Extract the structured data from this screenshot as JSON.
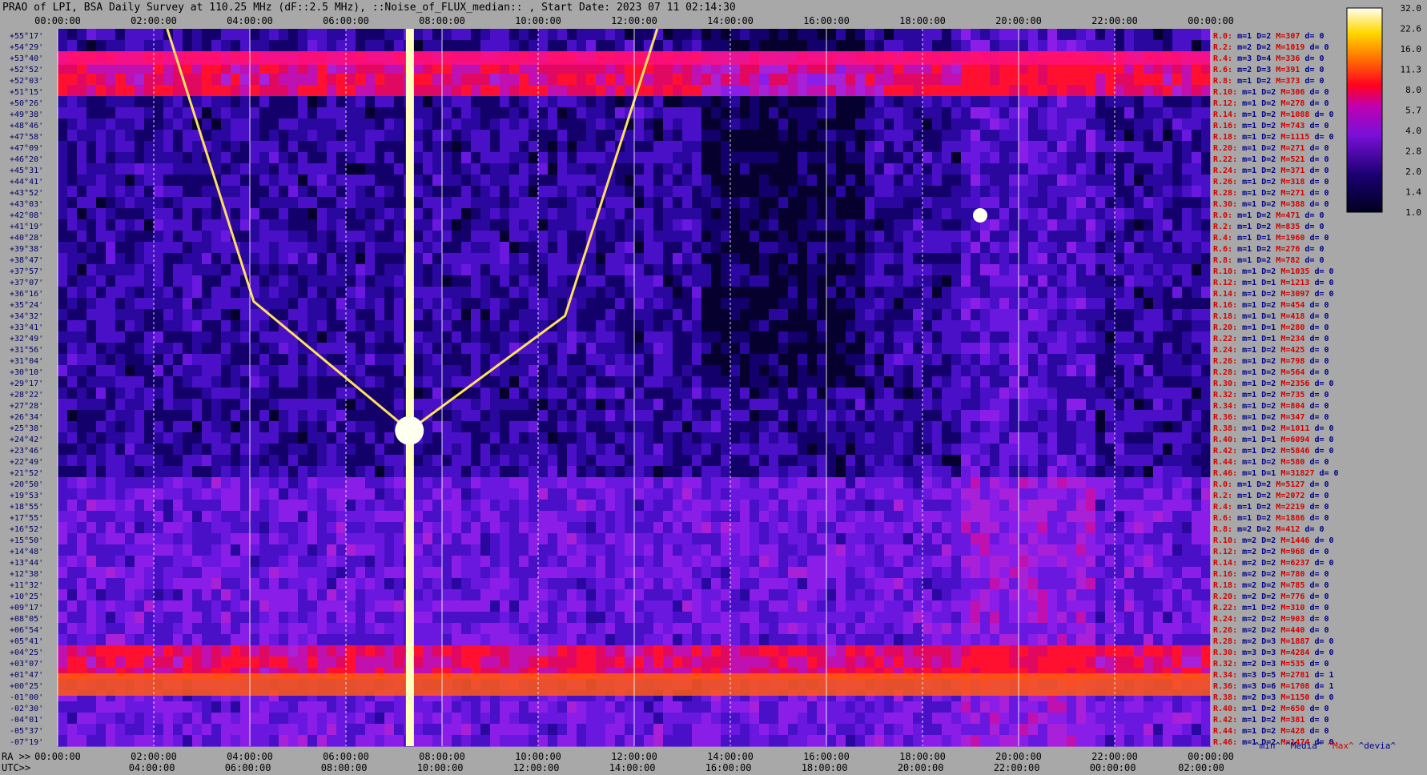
{
  "title": "PRAO of LPI, BSA Daily Survey at 110.25 MHz (dF::2.5 MHz), ::Noise_of_FLUX_median:: , Start Date: 2023 07 11 02:14:30",
  "colors": {
    "background": "#a8a8a8",
    "low": "#050030",
    "mid": "#8a1ee0",
    "high": "#ff1030",
    "peak": "#fffff0",
    "beam_label_red": "#d40000",
    "beam_label_blue": "#00008c",
    "gridline": "#ffffff"
  },
  "legend": [
    {
      "label": "^min^",
      "color": "#00008c"
    },
    {
      "label": "^Media^",
      "color": "#00008c"
    },
    {
      "label": "^Max^",
      "color": "#d40000"
    },
    {
      "label": "^devia^",
      "color": "#00008c"
    }
  ],
  "chart_data": {
    "type": "heatmap",
    "title": "PRAO of LPI, BSA Daily Survey at 110.25 MHz (dF::2.5 MHz), ::Noise_of_FLUX_median:: , Start Date: 2023 07 11 02:14:30",
    "x_axis_top": {
      "label": "",
      "ticks": [
        "00:00:00",
        "02:00:00",
        "04:00:00",
        "06:00:00",
        "08:00:00",
        "10:00:00",
        "12:00:00",
        "14:00:00",
        "16:00:00",
        "18:00:00",
        "20:00:00",
        "22:00:00",
        "00:00:00"
      ]
    },
    "x_axis_bottom_ra": {
      "label": "RA >>",
      "ticks": [
        "00:00:00",
        "02:00:00",
        "04:00:00",
        "06:00:00",
        "08:00:00",
        "10:00:00",
        "12:00:00",
        "14:00:00",
        "16:00:00",
        "18:00:00",
        "20:00:00",
        "22:00:00",
        "00:00:00"
      ]
    },
    "x_axis_bottom_utc": {
      "label": "UTC>>",
      "ticks": [
        "04:00:00",
        "06:00:00",
        "08:00:00",
        "10:00:00",
        "12:00:00",
        "14:00:00",
        "16:00:00",
        "18:00:00",
        "20:00:00",
        "22:00:00",
        "00:00:00",
        "02:00:00"
      ]
    },
    "y_declinations": [
      "+55°17'",
      "+54°29'",
      "+53°40'",
      "+52°52'",
      "+52°03'",
      "+51°15'",
      "+50°26'",
      "+49°38'",
      "+48°46'",
      "+47°58'",
      "+47°09'",
      "+46°20'",
      "+45°31'",
      "+44°41'",
      "+43°52'",
      "+43°03'",
      "+42°08'",
      "+41°19'",
      "+40°28'",
      "+39°38'",
      "+38°47'",
      "+37°57'",
      "+37°07'",
      "+36°16'",
      "+35°24'",
      "+34°32'",
      "+33°41'",
      "+32°49'",
      "+31°56'",
      "+31°04'",
      "+30°10'",
      "+29°17'",
      "+28°22'",
      "+27°28'",
      "+26°34'",
      "+25°38'",
      "+24°42'",
      "+23°46'",
      "+22°49'",
      "+21°52'",
      "+20°50'",
      "+19°53'",
      "+18°55'",
      "+17°55'",
      "+16°52'",
      "+15°50'",
      "+14°48'",
      "+13°44'",
      "+12°38'",
      "+11°32'",
      "+10°25'",
      "+09°17'",
      "+08°05'",
      "+06°54'",
      "+05°41'",
      "+04°25'",
      "+03°07'",
      "+01°47'",
      "+00°25'",
      "-01°00'",
      "-02°30'",
      "-04°01'",
      "-05°37'",
      "-07°19'"
    ],
    "colorbar": {
      "ticks": [
        "32.0",
        "22.6",
        "16.0",
        "11.3",
        "8.0",
        "5.7",
        "4.0",
        "2.8",
        "2.0",
        "1.4",
        "1.0"
      ],
      "scale": "log"
    },
    "beams": [
      {
        "name": "R.0:",
        "m": 1,
        "D": 2,
        "M": 307,
        "d": 0
      },
      {
        "name": "R.2:",
        "m": 2,
        "D": 2,
        "M": 1019,
        "d": 0
      },
      {
        "name": "R.4:",
        "m": 3,
        "D": 4,
        "M": 336,
        "d": 0
      },
      {
        "name": "R.6:",
        "m": 2,
        "D": 3,
        "M": 391,
        "d": 0
      },
      {
        "name": "R.8:",
        "m": 1,
        "D": 2,
        "M": 373,
        "d": 0
      },
      {
        "name": "R.10:",
        "m": 1,
        "D": 2,
        "M": 306,
        "d": 0
      },
      {
        "name": "R.12:",
        "m": 1,
        "D": 2,
        "M": 278,
        "d": 0
      },
      {
        "name": "R.14:",
        "m": 1,
        "D": 2,
        "M": 1088,
        "d": 0
      },
      {
        "name": "R.16:",
        "m": 1,
        "D": 2,
        "M": 743,
        "d": 0
      },
      {
        "name": "R.18:",
        "m": 1,
        "D": 2,
        "M": 1115,
        "d": 0
      },
      {
        "name": "R.20:",
        "m": 1,
        "D": 2,
        "M": 271,
        "d": 0
      },
      {
        "name": "R.22:",
        "m": 1,
        "D": 2,
        "M": 521,
        "d": 0
      },
      {
        "name": "R.24:",
        "m": 1,
        "D": 2,
        "M": 371,
        "d": 0
      },
      {
        "name": "R.26:",
        "m": 1,
        "D": 2,
        "M": 318,
        "d": 0
      },
      {
        "name": "R.28:",
        "m": 1,
        "D": 2,
        "M": 271,
        "d": 0
      },
      {
        "name": "R.30:",
        "m": 1,
        "D": 2,
        "M": 388,
        "d": 0
      },
      {
        "name": "R.0:",
        "m": 1,
        "D": 2,
        "M": 471,
        "d": 0
      },
      {
        "name": "R.2:",
        "m": 1,
        "D": 2,
        "M": 835,
        "d": 0
      },
      {
        "name": "R.4:",
        "m": 1,
        "D": 1,
        "M": 1960,
        "d": 0
      },
      {
        "name": "R.6:",
        "m": 1,
        "D": 2,
        "M": 276,
        "d": 0
      },
      {
        "name": "R.8:",
        "m": 1,
        "D": 2,
        "M": 782,
        "d": 0
      },
      {
        "name": "R.10:",
        "m": 1,
        "D": 2,
        "M": 1035,
        "d": 0
      },
      {
        "name": "R.12:",
        "m": 1,
        "D": 1,
        "M": 1213,
        "d": 0
      },
      {
        "name": "R.14:",
        "m": 1,
        "D": 2,
        "M": 3097,
        "d": 0
      },
      {
        "name": "R.16:",
        "m": 1,
        "D": 2,
        "M": 454,
        "d": 0
      },
      {
        "name": "R.18:",
        "m": 1,
        "D": 1,
        "M": 418,
        "d": 0
      },
      {
        "name": "R.20:",
        "m": 1,
        "D": 1,
        "M": 280,
        "d": 0
      },
      {
        "name": "R.22:",
        "m": 1,
        "D": 1,
        "M": 234,
        "d": 0
      },
      {
        "name": "R.24:",
        "m": 1,
        "D": 2,
        "M": 425,
        "d": 0
      },
      {
        "name": "R.26:",
        "m": 1,
        "D": 2,
        "M": 798,
        "d": 0
      },
      {
        "name": "R.28:",
        "m": 1,
        "D": 2,
        "M": 564,
        "d": 0
      },
      {
        "name": "R.30:",
        "m": 1,
        "D": 2,
        "M": 2356,
        "d": 0
      },
      {
        "name": "R.32:",
        "m": 1,
        "D": 2,
        "M": 735,
        "d": 0
      },
      {
        "name": "R.34:",
        "m": 1,
        "D": 2,
        "M": 804,
        "d": 0
      },
      {
        "name": "R.36:",
        "m": 1,
        "D": 2,
        "M": 347,
        "d": 0
      },
      {
        "name": "R.38:",
        "m": 1,
        "D": 2,
        "M": 1011,
        "d": 0
      },
      {
        "name": "R.40:",
        "m": 1,
        "D": 1,
        "M": 6094,
        "d": 0
      },
      {
        "name": "R.42:",
        "m": 1,
        "D": 2,
        "M": 5846,
        "d": 0
      },
      {
        "name": "R.44:",
        "m": 1,
        "D": 2,
        "M": 580,
        "d": 0
      },
      {
        "name": "R.46:",
        "m": 1,
        "D": 1,
        "M": 31827,
        "d": 0
      },
      {
        "name": "R.0:",
        "m": 1,
        "D": 2,
        "M": 5127,
        "d": 0
      },
      {
        "name": "R.2:",
        "m": 1,
        "D": 2,
        "M": 2072,
        "d": 0
      },
      {
        "name": "R.4:",
        "m": 1,
        "D": 2,
        "M": 2219,
        "d": 0
      },
      {
        "name": "R.6:",
        "m": 1,
        "D": 2,
        "M": 1886,
        "d": 0
      },
      {
        "name": "R.8:",
        "m": 2,
        "D": 2,
        "M": 412,
        "d": 0
      },
      {
        "name": "R.10:",
        "m": 2,
        "D": 2,
        "M": 1446,
        "d": 0
      },
      {
        "name": "R.12:",
        "m": 2,
        "D": 2,
        "M": 968,
        "d": 0
      },
      {
        "name": "R.14:",
        "m": 2,
        "D": 2,
        "M": 6237,
        "d": 0
      },
      {
        "name": "R.16:",
        "m": 2,
        "D": 2,
        "M": 780,
        "d": 0
      },
      {
        "name": "R.18:",
        "m": 2,
        "D": 2,
        "M": 785,
        "d": 0
      },
      {
        "name": "R.20:",
        "m": 2,
        "D": 2,
        "M": 776,
        "d": 0
      },
      {
        "name": "R.22:",
        "m": 1,
        "D": 2,
        "M": 310,
        "d": 0
      },
      {
        "name": "R.24:",
        "m": 2,
        "D": 2,
        "M": 903,
        "d": 0
      },
      {
        "name": "R.26:",
        "m": 2,
        "D": 2,
        "M": 440,
        "d": 0
      },
      {
        "name": "R.28:",
        "m": 2,
        "D": 3,
        "M": 1887,
        "d": 0
      },
      {
        "name": "R.30:",
        "m": 3,
        "D": 3,
        "M": 4284,
        "d": 0
      },
      {
        "name": "R.32:",
        "m": 2,
        "D": 3,
        "M": 535,
        "d": 0
      },
      {
        "name": "R.34:",
        "m": 3,
        "D": 5,
        "M": 2781,
        "d": 1
      },
      {
        "name": "R.36:",
        "m": 3,
        "D": 6,
        "M": 1708,
        "d": 1
      },
      {
        "name": "R.38:",
        "m": 2,
        "D": 3,
        "M": 1150,
        "d": 0
      },
      {
        "name": "R.40:",
        "m": 1,
        "D": 2,
        "M": 650,
        "d": 0
      },
      {
        "name": "R.42:",
        "m": 1,
        "D": 2,
        "M": 381,
        "d": 0
      },
      {
        "name": "R.44:",
        "m": 1,
        "D": 2,
        "M": 428,
        "d": 0
      },
      {
        "name": "R.46:",
        "m": 1,
        "D": 2,
        "M": 1474,
        "d": 0
      }
    ]
  }
}
